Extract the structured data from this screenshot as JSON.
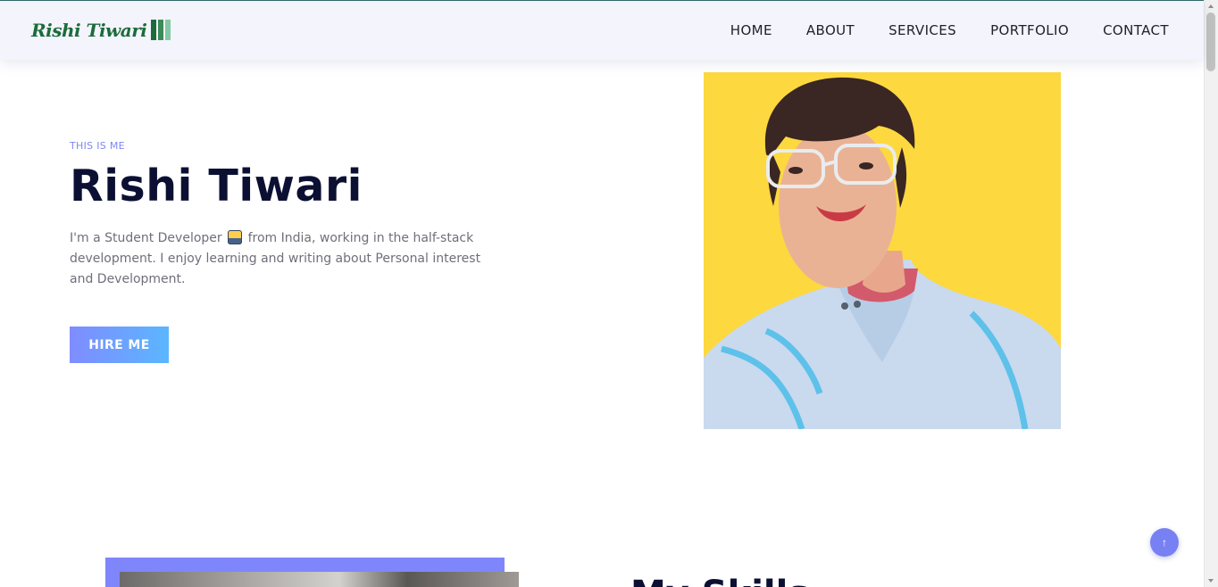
{
  "header": {
    "logo_text": "Rishi Tiwari",
    "logo_mark_colors": [
      "#1c6b3a",
      "#3c8b58",
      "#84c9a3"
    ],
    "nav": [
      {
        "label": "HOME"
      },
      {
        "label": "ABOUT"
      },
      {
        "label": "SERVICES"
      },
      {
        "label": "PORTFOLIO"
      },
      {
        "label": "CONTACT"
      }
    ]
  },
  "hero": {
    "eyebrow": "THIS IS ME",
    "name": "Rishi Tiwari",
    "bio_before": "I'm a Student Developer",
    "bio_emoji_icon": "technologist-emoji-icon",
    "bio_after": "from India, working in the half-stack development. I enjoy learning and writing about Personal interest and Development.",
    "cta_label": "HIRE ME",
    "portrait_background": "#fdd83f"
  },
  "skills": {
    "heading": "My Skills",
    "frame_color": "#7f86fb"
  },
  "scroll_top": {
    "label": "↑",
    "color": "#7881f3"
  },
  "colors": {
    "accent": "#7e87f5",
    "heading": "#0b1033",
    "body_text": "#6f6f7a",
    "header_bg": "#f3f4fc"
  }
}
